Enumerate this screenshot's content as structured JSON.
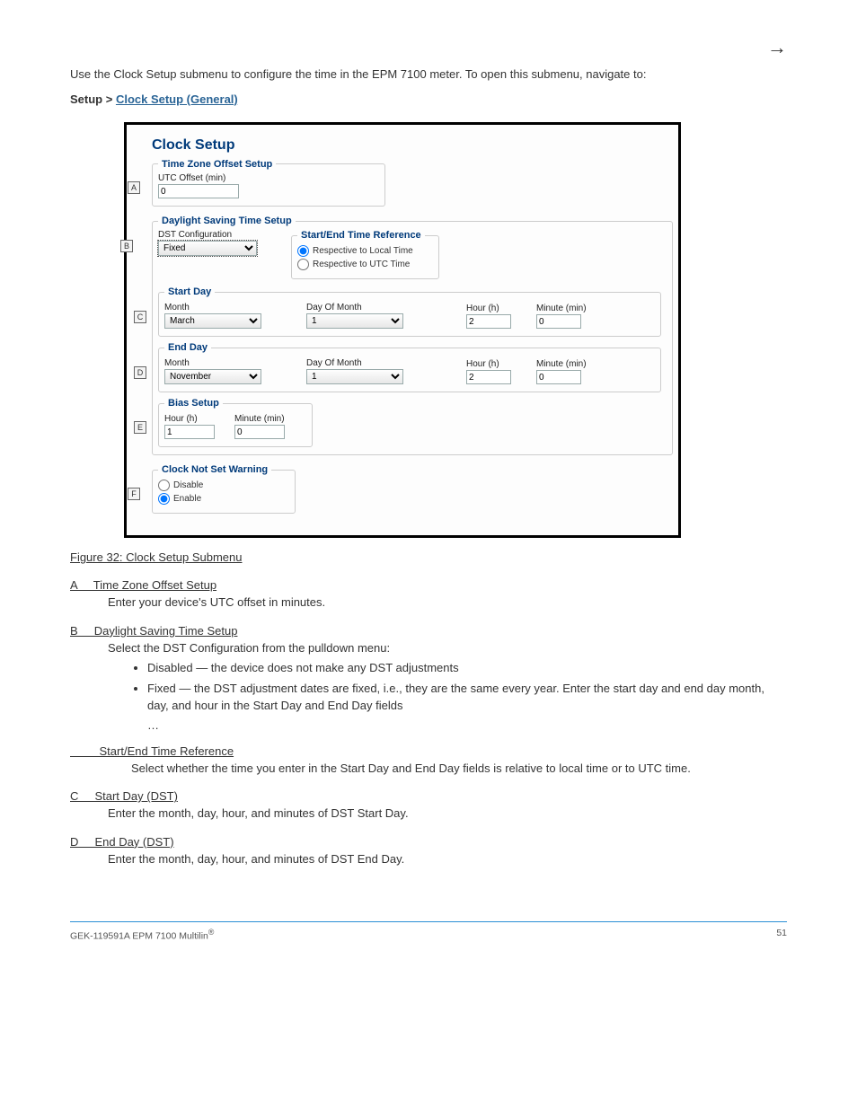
{
  "header": {
    "left": "",
    "arrow": "→"
  },
  "intro": {
    "para": "Use the Clock Setup submenu to configure the time in the EPM 7100 meter. To open this submenu, navigate to:",
    "nav_prefix": "Setup > ",
    "nav_link": "Clock Setup (General)"
  },
  "figure": {
    "title": "Clock Setup",
    "tz_legend": "Time Zone Offset Setup",
    "tz_label": "UTC Offset (min)",
    "tz_value": "0",
    "marker_A": "A",
    "dst_legend": "Daylight Saving Time Setup",
    "dst_cfg_label": "DST Configuration",
    "dst_cfg_value": "Fixed",
    "marker_B": "B",
    "ref_legend": "Start/End Time Reference",
    "ref_local": "Respective to Local Time",
    "ref_utc": "Respective to UTC Time",
    "start_legend": "Start Day",
    "end_legend": "End Day",
    "col_month": "Month",
    "col_dom": "Day Of Month",
    "col_hour": "Hour (h)",
    "col_min": "Minute (min)",
    "start_month": "March",
    "start_dom": "1",
    "start_hour": "2",
    "start_min": "0",
    "marker_C": "C",
    "end_month": "November",
    "end_dom": "1",
    "end_hour": "2",
    "end_min": "0",
    "marker_D": "D",
    "bias_legend": "Bias Setup",
    "bias_hour": "1",
    "bias_min": "0",
    "marker_E": "E",
    "warn_legend": "Clock Not Set Warning",
    "warn_disable": "Disable",
    "warn_enable": "Enable",
    "marker_F": "F"
  },
  "fignum": {
    "label": "Figure 32: Clock Setup Submenu"
  },
  "settings": {
    "A": {
      "key": "A     Time Zone Offset Setup",
      "body": "Enter your device's UTC offset in minutes."
    },
    "B": {
      "key": "B     Daylight Saving Time Setup",
      "body": "Select the DST Configuration from the pulldown menu:",
      "opts": [
        "Disabled — the device does not make any DST adjustments",
        "Fixed — the DST adjustment dates are fixed, i.e., they are the same every year. Enter the start day and end day month, day, and hour in the Start Day and End Day fields"
      ],
      "more": "…"
    },
    "Bref": {
      "key": "         Start/End Time Reference",
      "body": "Select whether the time you enter in the Start Day and End Day fields is relative to local time or to UTC time."
    },
    "C": {
      "key": "C     Start Day (DST)",
      "body": "Enter the month, day, hour, and minutes of DST Start Day."
    },
    "D": {
      "key": "D     End Day (DST)",
      "body": "Enter the month, day, hour, and minutes of DST End Day."
    }
  },
  "footer": {
    "left": "GEK-119591A     EPM 7100 Multilin",
    "tm": "®",
    "right": "51"
  }
}
